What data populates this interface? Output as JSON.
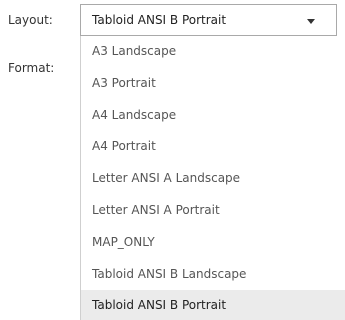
{
  "form": {
    "layout_label": "Layout:",
    "format_label": "Format:"
  },
  "layout_select": {
    "selected": "Tabloid ANSI B Portrait",
    "options": [
      "A3 Landscape",
      "A3 Portrait",
      "A4 Landscape",
      "A4 Portrait",
      "Letter ANSI A Landscape",
      "Letter ANSI A Portrait",
      "MAP_ONLY",
      "Tabloid ANSI B Landscape",
      "Tabloid ANSI B Portrait"
    ],
    "icon": "caret-down-icon"
  },
  "colors": {
    "selected_option_bg": "#ebebeb",
    "border": "#a9a9a9"
  }
}
